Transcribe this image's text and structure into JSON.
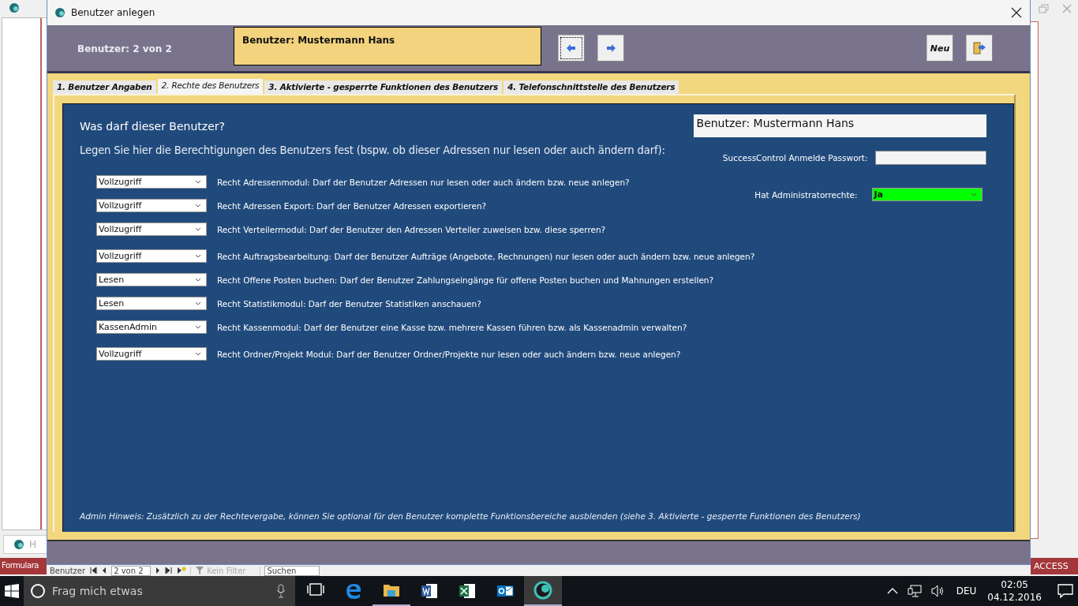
{
  "background_window": {
    "left_label": "H",
    "form_tab": "Formulara",
    "access_label": "ACCESS",
    "nav": {
      "label": "Benutzer",
      "record": "2 von 2",
      "filter": "Kein Filter",
      "search": "Suchen"
    }
  },
  "window": {
    "title": "Benutzer anlegen"
  },
  "header": {
    "record_counter": "Benutzer: 2 von 2",
    "name_box": "Benutzer: Mustermann Hans",
    "new_button": "Neu"
  },
  "tabs": [
    {
      "label": "1. Benutzer Angaben",
      "selected": false
    },
    {
      "label": "2. Rechte des Benutzers",
      "selected": true
    },
    {
      "label": "3. Aktivierte - gesperrte Funktionen des Benutzers",
      "selected": false
    },
    {
      "label": "4. Telefonschnittstelle des Benutzers",
      "selected": false
    }
  ],
  "panel": {
    "heading": "Was darf dieser Benutzer?",
    "user_name": "Benutzer: Mustermann Hans",
    "intro": "Legen Sie hier die Berechtigungen des Benutzers fest (bspw. ob dieser Adressen nur lesen oder auch ändern darf):",
    "password": {
      "label": "SuccessControl Anmelde Passwort:"
    },
    "admin": {
      "label": "Hat Administratorrechte:",
      "value": "Ja",
      "color": "#00ff00"
    },
    "rights_groups": [
      [
        {
          "value": "Vollzugriff",
          "label": "Recht Adressenmodul: Darf der Benutzer Adressen nur lesen oder auch ändern bzw. neue anlegen?"
        },
        {
          "value": "Vollzugriff",
          "label": "Recht Adressen Export: Darf der Benutzer Adressen exportieren?"
        },
        {
          "value": "Vollzugriff",
          "label": "Recht Verteilermodul: Darf der Benutzer den Adressen Verteiler zuweisen bzw. diese sperren?"
        }
      ],
      [
        {
          "value": "Vollzugriff",
          "label": "Recht Auftragsbearbeitung: Darf der Benutzer Aufträge (Angebote, Rechnungen) nur lesen oder auch ändern bzw. neue anlegen?"
        },
        {
          "value": "Lesen",
          "label": "Recht Offene Posten buchen: Darf der Benutzer Zahlungseingänge für offene Posten buchen und Mahnungen erstellen?"
        },
        {
          "value": "Lesen",
          "label": "Recht Statistikmodul: Darf der Benutzer Statistiken anschauen?"
        },
        {
          "value": "KassenAdmin",
          "label": "Recht Kassenmodul: Darf der Benutzer eine Kasse bzw. mehrere Kassen führen bzw. als Kassenadmin verwalten?"
        }
      ],
      [
        {
          "value": "Vollzugriff",
          "label": "Recht Ordner/Projekt Modul: Darf der Benutzer Ordner/Projekte nur lesen oder auch ändern bzw. neue anlegen?"
        }
      ]
    ],
    "footer_note": "Admin Hinweis: Zusätzlich zu der Rechtevergabe, können Sie optional für den Benutzer komplette Funktionsbereiche ausblenden (siehe 3. Aktivierte - gesperrte Funktionen des Benutzers)"
  },
  "taskbar": {
    "search_placeholder": "Frag mich etwas",
    "language": "DEU",
    "time": "02:05",
    "date": "04.12.2016"
  }
}
